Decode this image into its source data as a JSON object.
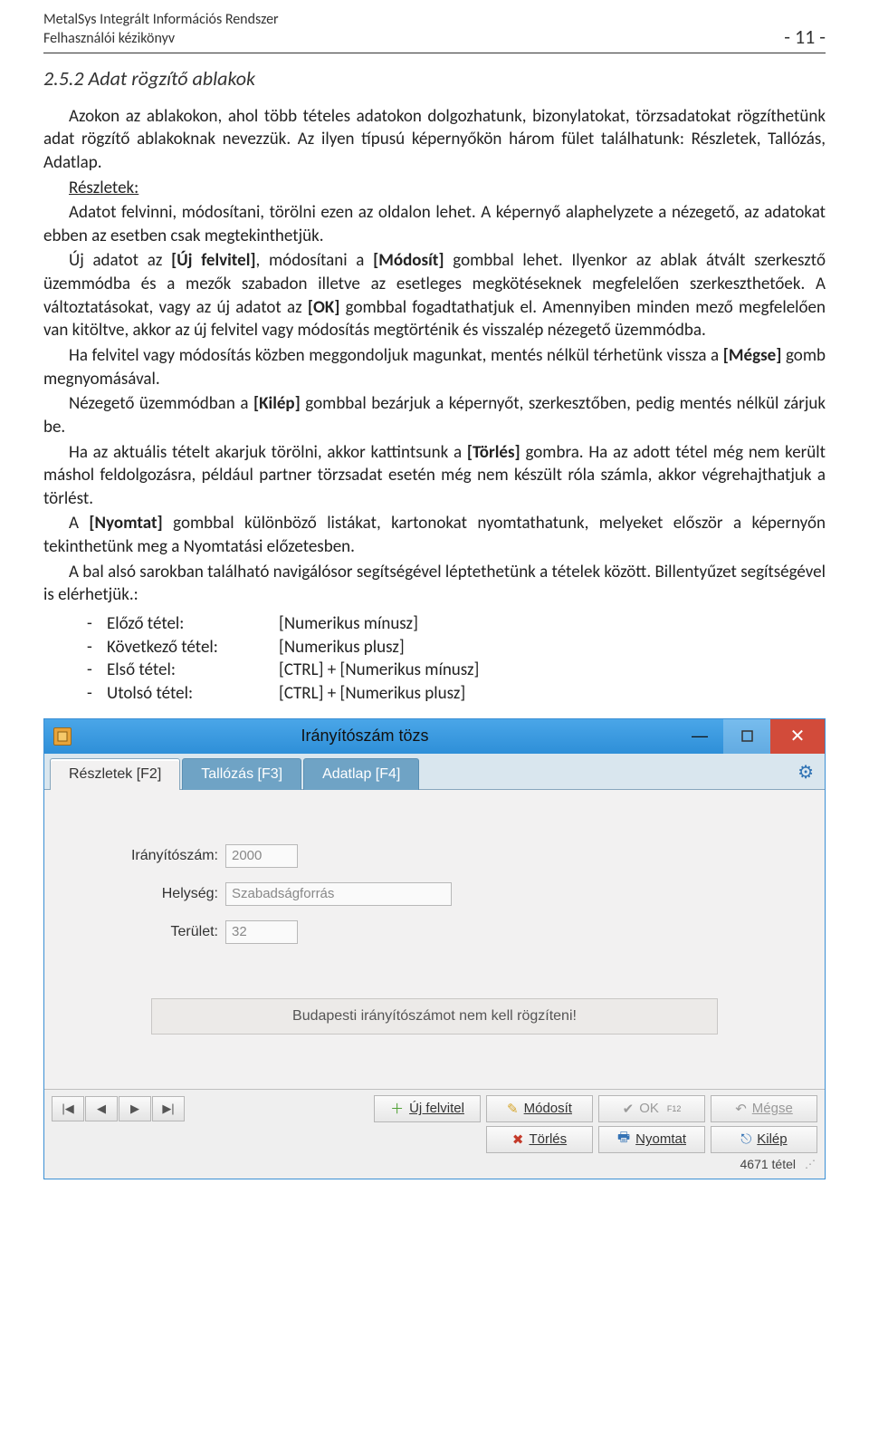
{
  "doc_header": {
    "line1": "MetalSys Integrált Információs Rendszer",
    "line2": "Felhasználói kézikönyv",
    "page_no": "- 11 -"
  },
  "section_title": "2.5.2 Adat rögzítő ablakok",
  "paragraphs": {
    "p1a": "Azokon az ablakokon, ahol több tételes adatokon dolgozhatunk, bizonylatokat, törzsadatokat rögzíthetünk adat rögzítő ablakoknak nevezzük. Az ilyen típusú képernyőkön három fület találhatunk: Részletek, Tallózás, Adatlap.",
    "reszletek_label": "Részletek:",
    "p2a": "Adatot felvinni, módosítani, törölni ezen az oldalon lehet. A képernyő alaphelyzete a nézegető, az adatokat ebben az esetben csak megtekinthetjük.",
    "p3a": "Új adatot az ",
    "p3b": "[Új felvitel]",
    "p3c": ", módosítani a ",
    "p3d": "[Módosít]",
    "p3e": " gombbal lehet. Ilyenkor az ablak átvált szerkesztő üzemmódba és a mezők szabadon illetve az esetleges megkötéseknek megfelelően szerkeszthetőek. A változtatásokat, vagy az új adatot az ",
    "p3f": "[OK]",
    "p3g": " gombbal fogadtathatjuk el. Amennyiben minden mező megfelelően van kitöltve, akkor az új felvitel vagy módosítás megtörténik és visszalép nézegető üzemmódba.",
    "p4a": "Ha felvitel vagy módosítás közben meggondoljuk magunkat, mentés nélkül térhetünk vissza a ",
    "p4b": "[Mégse]",
    "p4c": " gomb megnyomásával.",
    "p5a": "Nézegető üzemmódban a ",
    "p5b": "[Kilép]",
    "p5c": " gombbal bezárjuk a képernyőt, szerkesztőben, pedig mentés nélkül zárjuk be.",
    "p6a": "Ha az aktuális tételt akarjuk törölni, akkor kattintsunk a ",
    "p6b": "[Törlés]",
    "p6c": " gombra. Ha az adott tétel még nem került máshol feldolgozásra, például partner törzsadat esetén még nem készült róla számla, akkor végrehajthatjuk a törlést.",
    "p7a": "A ",
    "p7b": "[Nyomtat]",
    "p7c": " gombbal különböző listákat, kartonokat nyomtathatunk, melyeket először a képernyőn tekinthetünk meg a Nyomtatási előzetesben.",
    "p8": "A bal alsó sarokban található navigálósor segítségével léptethetünk a tételek között. Billentyűzet segítségével is elérhetjük.:"
  },
  "kb_shortcuts": [
    {
      "label": "Előző tétel:",
      "value": "[Numerikus mínusz]"
    },
    {
      "label": "Következő tétel:",
      "value": "[Numerikus plusz]"
    },
    {
      "label": "Első tétel:",
      "value": "[CTRL] + [Numerikus mínusz]"
    },
    {
      "label": "Utolsó tétel:",
      "value": "[CTRL] + [Numerikus plusz]"
    }
  ],
  "app": {
    "title": "Irányítószám tözs",
    "tabs": [
      {
        "label": "Részletek [F2]",
        "active": true
      },
      {
        "label": "Tallózás [F3]",
        "active": false
      },
      {
        "label": "Adatlap [F4]",
        "active": false
      }
    ],
    "fields": {
      "iranyitoszam_label": "Irányítószám:",
      "iranyitoszam_value": "2000",
      "helyseg_label": "Helység:",
      "helyseg_value": "Szabadságforrás",
      "terulet_label": "Terület:",
      "terulet_value": "32"
    },
    "status_message": "Budapesti irányítószámot nem kell rögzíteni!",
    "buttons": {
      "uj_felvitel": "Új felvitel",
      "modosit": "Módosít",
      "ok": "OK",
      "ok_sup": "F12",
      "megse": "Mégse",
      "torles": "Törlés",
      "nyomtat": "Nyomtat",
      "kilep": "Kilép"
    },
    "tetel_count": "4671 tétel"
  }
}
